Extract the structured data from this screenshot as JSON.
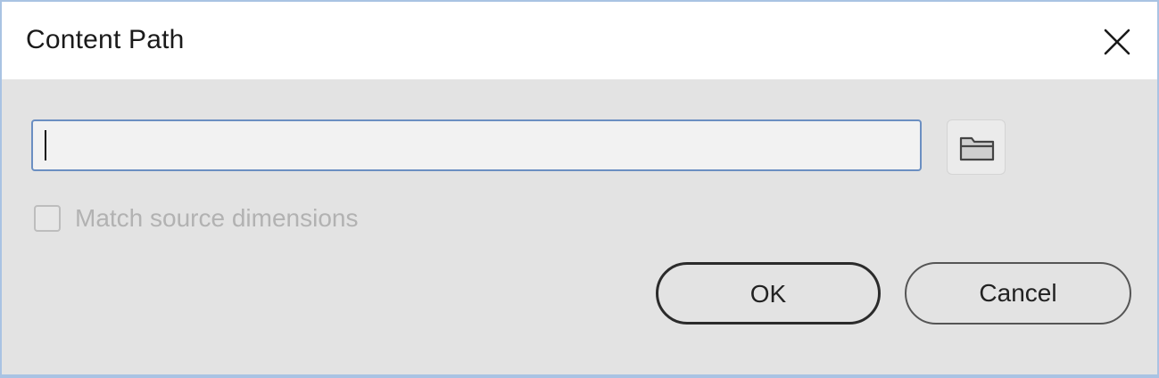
{
  "dialog": {
    "title": "Content Path",
    "close_icon": "close-icon"
  },
  "path_field": {
    "value": "",
    "placeholder": ""
  },
  "browse": {
    "icon": "folder-icon"
  },
  "match_source": {
    "label": "Match source dimensions",
    "checked": false,
    "enabled": false
  },
  "buttons": {
    "ok_label": "OK",
    "cancel_label": "Cancel"
  },
  "colors": {
    "body_background": "#e3e3e3",
    "titlebar_background": "#ffffff",
    "input_focus_border": "#6b8fc2",
    "disabled_text": "#b2b2b2"
  }
}
